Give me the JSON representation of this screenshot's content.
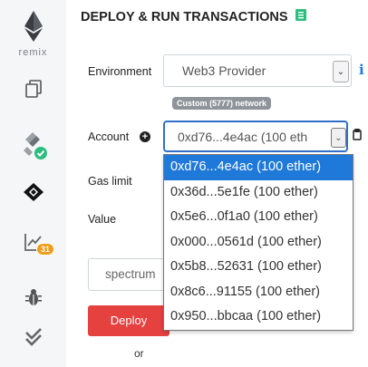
{
  "sidebar": {
    "logo_text": "remix",
    "plugin_badge_count": "31"
  },
  "panel": {
    "title": "DEPLOY & RUN TRANSACTIONS"
  },
  "environment": {
    "label": "Environment",
    "value": "Web3 Provider",
    "network_badge": "Custom (5777) network"
  },
  "account": {
    "label": "Account",
    "value": "0xd76...4e4ac (100 eth",
    "options": [
      "0xd76...4e4ac (100 ether)",
      "0x36d...5e1fe (100 ether)",
      "0x5e6...0f1a0 (100 ether)",
      "0x000...0561d (100 ether)",
      "0x5b8...52631 (100 ether)",
      "0x8c6...91155 (100 ether)",
      "0x950...bbcaa (100 ether)"
    ]
  },
  "gas_limit": {
    "label": "Gas limit"
  },
  "value_field": {
    "label": "Value"
  },
  "contract": {
    "value": "spectrum"
  },
  "deploy": {
    "label": "Deploy",
    "or_text": "or"
  },
  "colors": {
    "accent": "#1f79d8",
    "deploy": "#e5413f",
    "success": "#2dbd7e",
    "badge": "#f19b1b"
  }
}
